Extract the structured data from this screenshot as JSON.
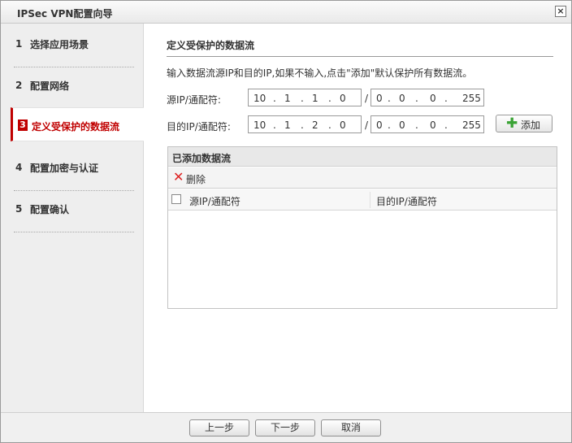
{
  "window": {
    "title": "IPSec VPN配置向导",
    "close_glyph": "×"
  },
  "sidebar": {
    "steps": [
      {
        "num": "1",
        "label": "选择应用场景"
      },
      {
        "num": "2",
        "label": "配置网络"
      },
      {
        "num": "3",
        "label": "定义受保护的数据流"
      },
      {
        "num": "4",
        "label": "配置加密与认证"
      },
      {
        "num": "5",
        "label": "配置确认"
      }
    ],
    "active_index": 2
  },
  "main": {
    "title": "定义受保护的数据流",
    "hint": "输入数据流源IP和目的IP,如果不输入,点击\"添加\"默认保护所有数据流。",
    "source": {
      "label": "源IP/通配符:",
      "ip": [
        "10",
        "1",
        "1",
        "0"
      ],
      "wildcard": [
        "0",
        "0",
        "0",
        "255"
      ]
    },
    "dest": {
      "label": "目的IP/通配符:",
      "ip": [
        "10",
        "1",
        "2",
        "0"
      ],
      "wildcard": [
        "0",
        "0",
        "0",
        "255"
      ]
    },
    "slash": "/",
    "dot": ".",
    "add_button": "添加",
    "table": {
      "title": "已添加数据流",
      "delete_button": "删除",
      "columns": [
        "源IP/通配符",
        "目的IP/通配符"
      ],
      "rows": []
    }
  },
  "footer": {
    "prev": "上一步",
    "next": "下一步",
    "cancel": "取消"
  },
  "colors": {
    "accent": "#c00000",
    "add_icon": "#3aa335",
    "delete_icon": "#dd2222"
  },
  "icons": {
    "add": "plus-icon",
    "delete": "x-icon",
    "close": "close-icon"
  }
}
